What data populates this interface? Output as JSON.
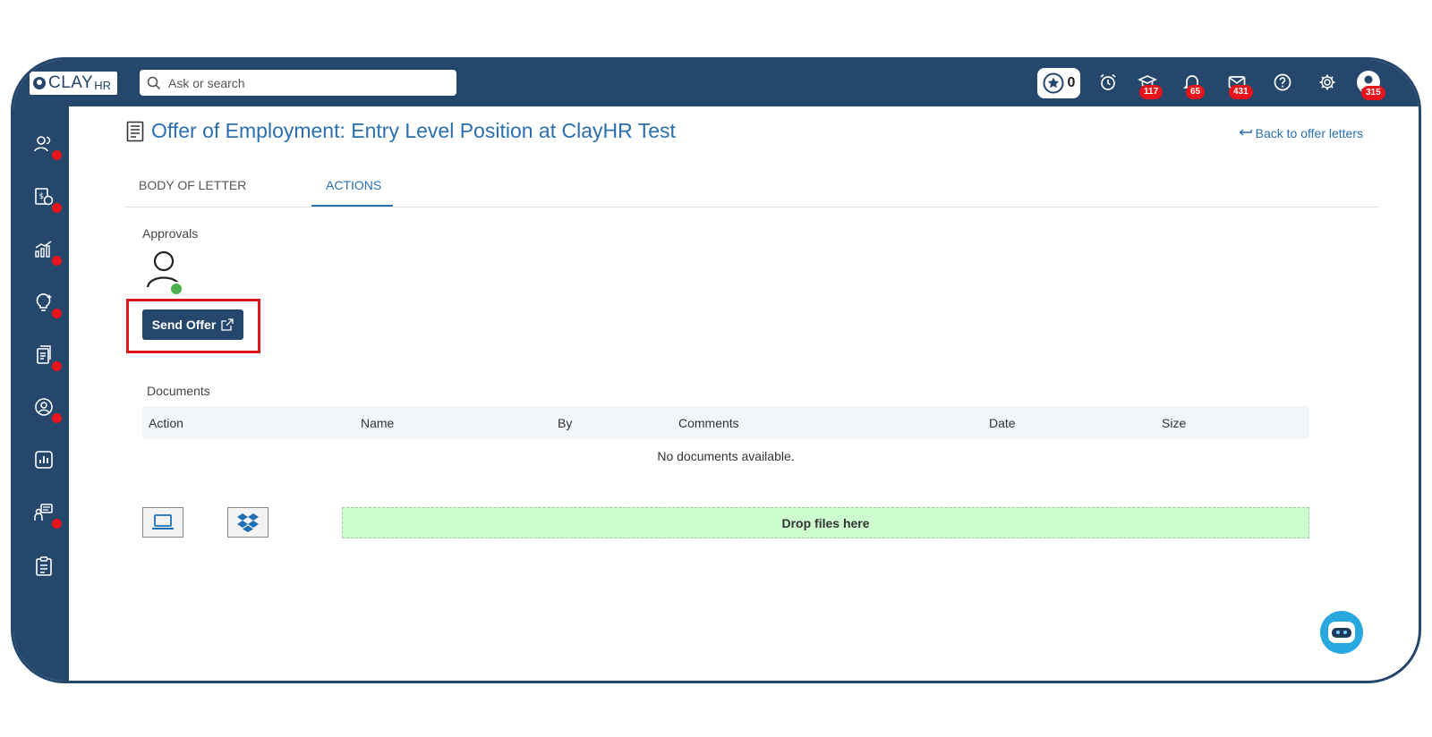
{
  "brand": {
    "name_main": "CLAY",
    "name_suffix": "HR"
  },
  "search": {
    "placeholder": "Ask or search"
  },
  "topbar": {
    "star_count": "0",
    "badges": {
      "courses": "117",
      "notifications": "65",
      "messages": "431",
      "profile": "315"
    }
  },
  "page": {
    "title": "Offer of Employment: Entry Level Position at ClayHR Test",
    "back_link": "Back to offer letters"
  },
  "tabs": [
    {
      "label": "BODY OF LETTER",
      "active": false
    },
    {
      "label": "ACTIONS",
      "active": true
    }
  ],
  "approvals": {
    "label": "Approvals",
    "send_button": "Send Offer"
  },
  "documents": {
    "label": "Documents",
    "columns": [
      "Action",
      "Name",
      "By",
      "Comments",
      "Date",
      "Size"
    ],
    "empty_text": "No documents available.",
    "drop_zone": "Drop files here"
  },
  "colors": {
    "brand": "#24476b",
    "accent": "#2a6fb0",
    "badge": "#e8141b",
    "drop_zone": "#cdfccf",
    "highlight": "#e0141b"
  }
}
